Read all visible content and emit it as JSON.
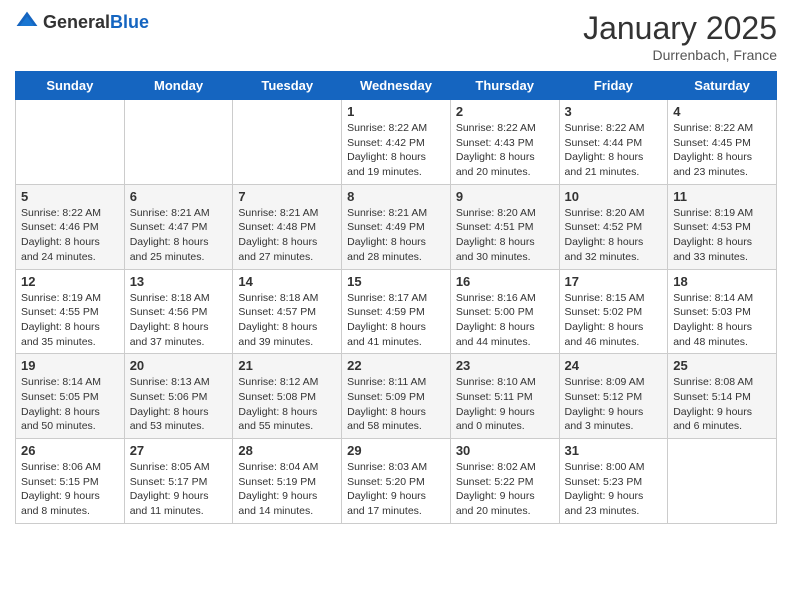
{
  "header": {
    "logo_general": "General",
    "logo_blue": "Blue",
    "month_title": "January 2025",
    "location": "Durrenbach, France"
  },
  "weekdays": [
    "Sunday",
    "Monday",
    "Tuesday",
    "Wednesday",
    "Thursday",
    "Friday",
    "Saturday"
  ],
  "weeks": [
    [
      {
        "day": "",
        "info": ""
      },
      {
        "day": "",
        "info": ""
      },
      {
        "day": "",
        "info": ""
      },
      {
        "day": "1",
        "info": "Sunrise: 8:22 AM\nSunset: 4:42 PM\nDaylight: 8 hours\nand 19 minutes."
      },
      {
        "day": "2",
        "info": "Sunrise: 8:22 AM\nSunset: 4:43 PM\nDaylight: 8 hours\nand 20 minutes."
      },
      {
        "day": "3",
        "info": "Sunrise: 8:22 AM\nSunset: 4:44 PM\nDaylight: 8 hours\nand 21 minutes."
      },
      {
        "day": "4",
        "info": "Sunrise: 8:22 AM\nSunset: 4:45 PM\nDaylight: 8 hours\nand 23 minutes."
      }
    ],
    [
      {
        "day": "5",
        "info": "Sunrise: 8:22 AM\nSunset: 4:46 PM\nDaylight: 8 hours\nand 24 minutes."
      },
      {
        "day": "6",
        "info": "Sunrise: 8:21 AM\nSunset: 4:47 PM\nDaylight: 8 hours\nand 25 minutes."
      },
      {
        "day": "7",
        "info": "Sunrise: 8:21 AM\nSunset: 4:48 PM\nDaylight: 8 hours\nand 27 minutes."
      },
      {
        "day": "8",
        "info": "Sunrise: 8:21 AM\nSunset: 4:49 PM\nDaylight: 8 hours\nand 28 minutes."
      },
      {
        "day": "9",
        "info": "Sunrise: 8:20 AM\nSunset: 4:51 PM\nDaylight: 8 hours\nand 30 minutes."
      },
      {
        "day": "10",
        "info": "Sunrise: 8:20 AM\nSunset: 4:52 PM\nDaylight: 8 hours\nand 32 minutes."
      },
      {
        "day": "11",
        "info": "Sunrise: 8:19 AM\nSunset: 4:53 PM\nDaylight: 8 hours\nand 33 minutes."
      }
    ],
    [
      {
        "day": "12",
        "info": "Sunrise: 8:19 AM\nSunset: 4:55 PM\nDaylight: 8 hours\nand 35 minutes."
      },
      {
        "day": "13",
        "info": "Sunrise: 8:18 AM\nSunset: 4:56 PM\nDaylight: 8 hours\nand 37 minutes."
      },
      {
        "day": "14",
        "info": "Sunrise: 8:18 AM\nSunset: 4:57 PM\nDaylight: 8 hours\nand 39 minutes."
      },
      {
        "day": "15",
        "info": "Sunrise: 8:17 AM\nSunset: 4:59 PM\nDaylight: 8 hours\nand 41 minutes."
      },
      {
        "day": "16",
        "info": "Sunrise: 8:16 AM\nSunset: 5:00 PM\nDaylight: 8 hours\nand 44 minutes."
      },
      {
        "day": "17",
        "info": "Sunrise: 8:15 AM\nSunset: 5:02 PM\nDaylight: 8 hours\nand 46 minutes."
      },
      {
        "day": "18",
        "info": "Sunrise: 8:14 AM\nSunset: 5:03 PM\nDaylight: 8 hours\nand 48 minutes."
      }
    ],
    [
      {
        "day": "19",
        "info": "Sunrise: 8:14 AM\nSunset: 5:05 PM\nDaylight: 8 hours\nand 50 minutes."
      },
      {
        "day": "20",
        "info": "Sunrise: 8:13 AM\nSunset: 5:06 PM\nDaylight: 8 hours\nand 53 minutes."
      },
      {
        "day": "21",
        "info": "Sunrise: 8:12 AM\nSunset: 5:08 PM\nDaylight: 8 hours\nand 55 minutes."
      },
      {
        "day": "22",
        "info": "Sunrise: 8:11 AM\nSunset: 5:09 PM\nDaylight: 8 hours\nand 58 minutes."
      },
      {
        "day": "23",
        "info": "Sunrise: 8:10 AM\nSunset: 5:11 PM\nDaylight: 9 hours\nand 0 minutes."
      },
      {
        "day": "24",
        "info": "Sunrise: 8:09 AM\nSunset: 5:12 PM\nDaylight: 9 hours\nand 3 minutes."
      },
      {
        "day": "25",
        "info": "Sunrise: 8:08 AM\nSunset: 5:14 PM\nDaylight: 9 hours\nand 6 minutes."
      }
    ],
    [
      {
        "day": "26",
        "info": "Sunrise: 8:06 AM\nSunset: 5:15 PM\nDaylight: 9 hours\nand 8 minutes."
      },
      {
        "day": "27",
        "info": "Sunrise: 8:05 AM\nSunset: 5:17 PM\nDaylight: 9 hours\nand 11 minutes."
      },
      {
        "day": "28",
        "info": "Sunrise: 8:04 AM\nSunset: 5:19 PM\nDaylight: 9 hours\nand 14 minutes."
      },
      {
        "day": "29",
        "info": "Sunrise: 8:03 AM\nSunset: 5:20 PM\nDaylight: 9 hours\nand 17 minutes."
      },
      {
        "day": "30",
        "info": "Sunrise: 8:02 AM\nSunset: 5:22 PM\nDaylight: 9 hours\nand 20 minutes."
      },
      {
        "day": "31",
        "info": "Sunrise: 8:00 AM\nSunset: 5:23 PM\nDaylight: 9 hours\nand 23 minutes."
      },
      {
        "day": "",
        "info": ""
      }
    ]
  ]
}
